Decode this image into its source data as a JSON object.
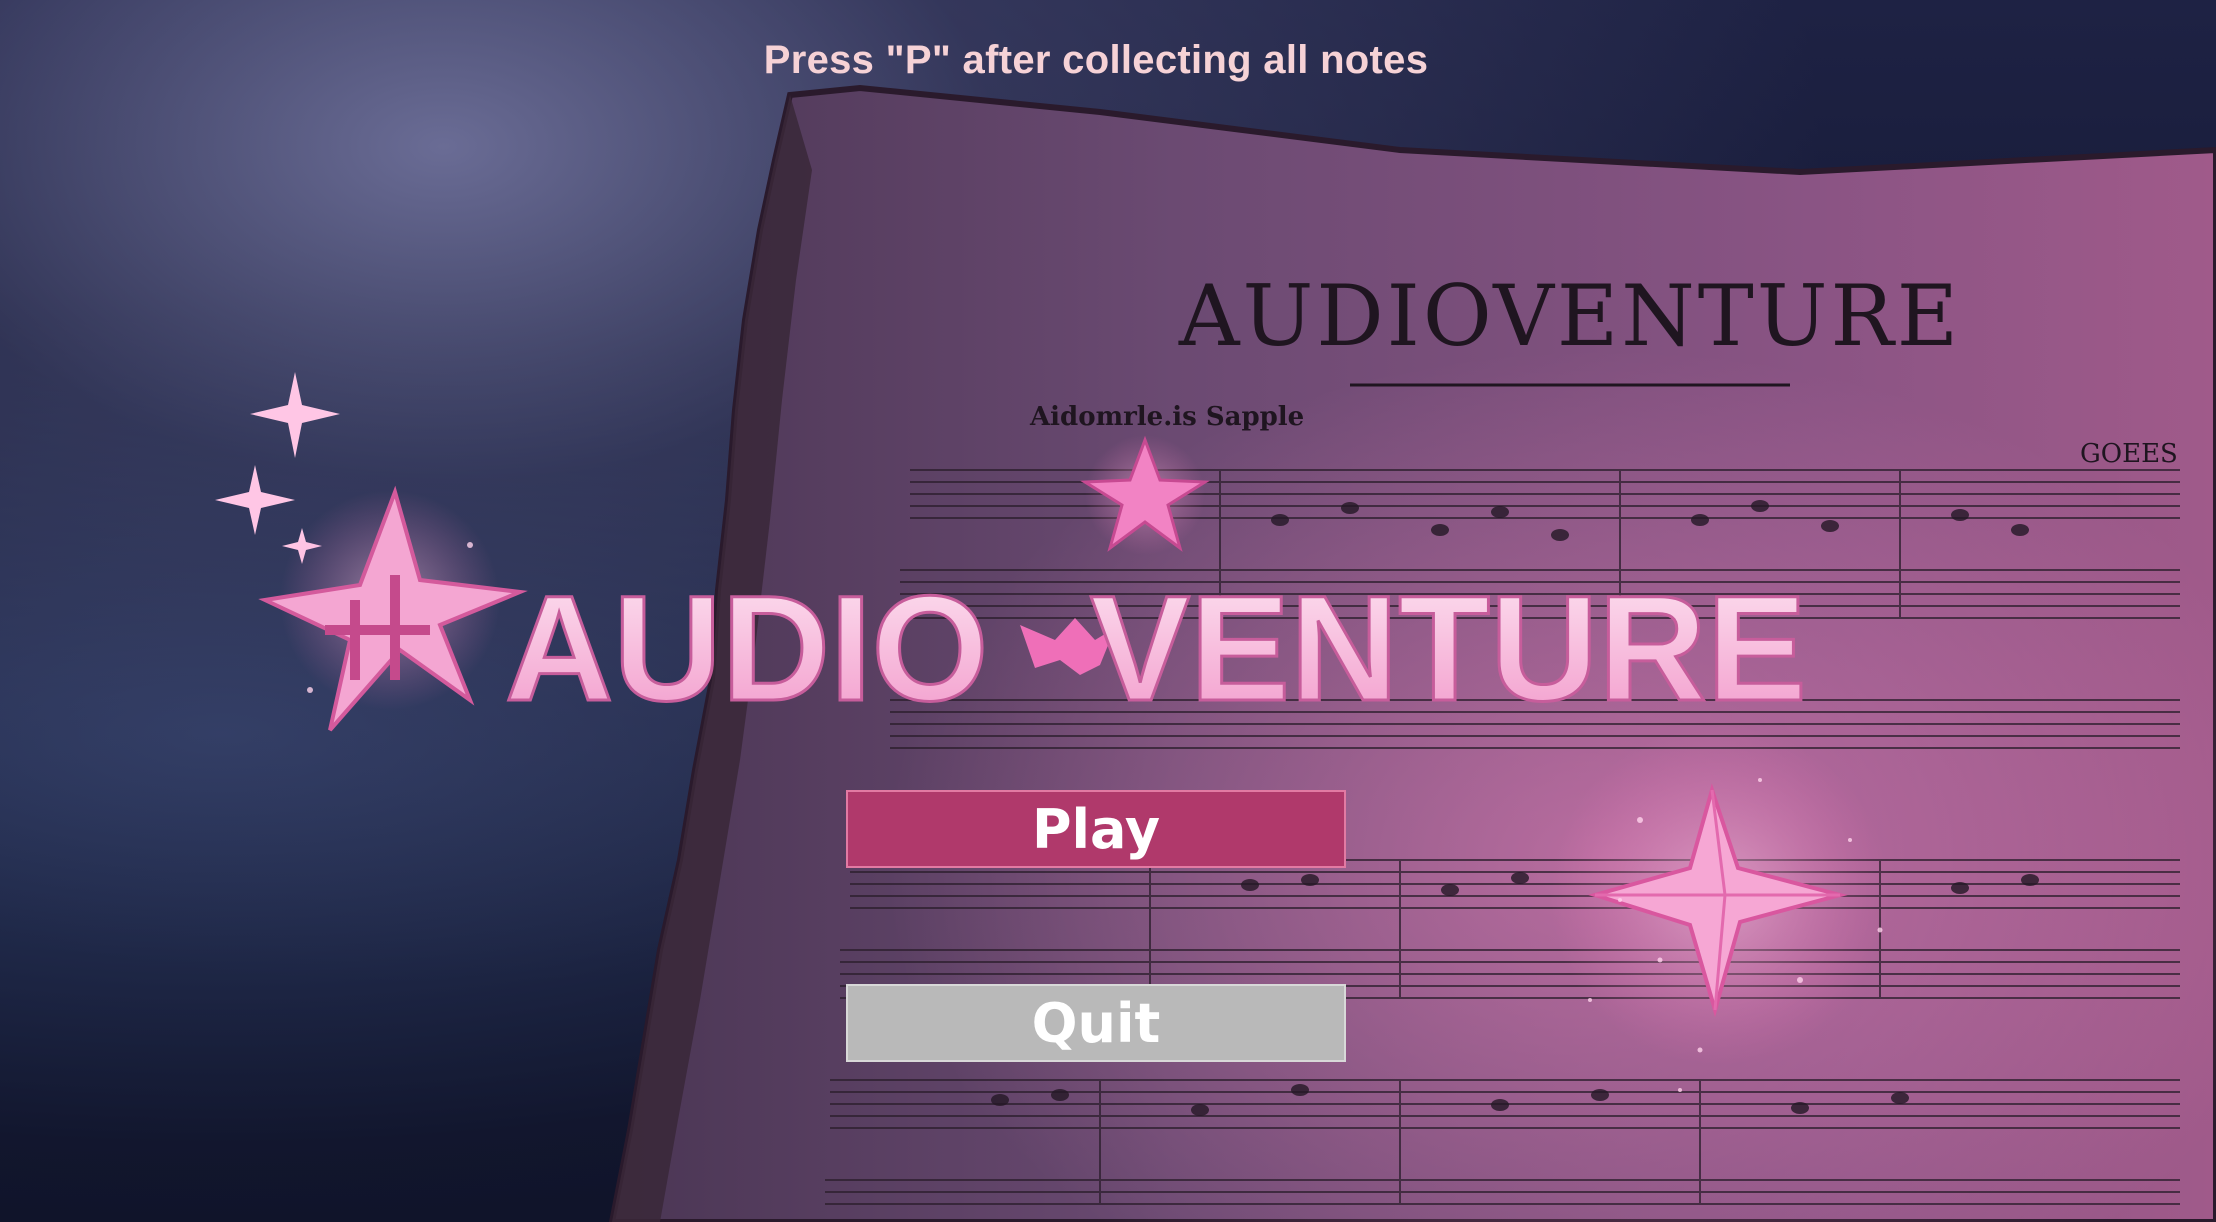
{
  "hint": {
    "text": "Press \"P\" after collecting all notes"
  },
  "logo": {
    "title": "AUDIOVENTURE",
    "part1": "AUDIO",
    "part2": "VENTURE"
  },
  "sheet": {
    "heading": "AUDIOVENTURE",
    "subtitle": "Aidomrle.is Sapple",
    "side_label": "GOEES"
  },
  "menu": {
    "play_label": "Play",
    "quit_label": "Quit"
  },
  "colors": {
    "play_button": "#b0396b",
    "quit_button": "#b9b9b9",
    "hint_text": "#f6d2d6",
    "logo_pink": "#f7b8da",
    "star_pink": "#f06bb6"
  }
}
